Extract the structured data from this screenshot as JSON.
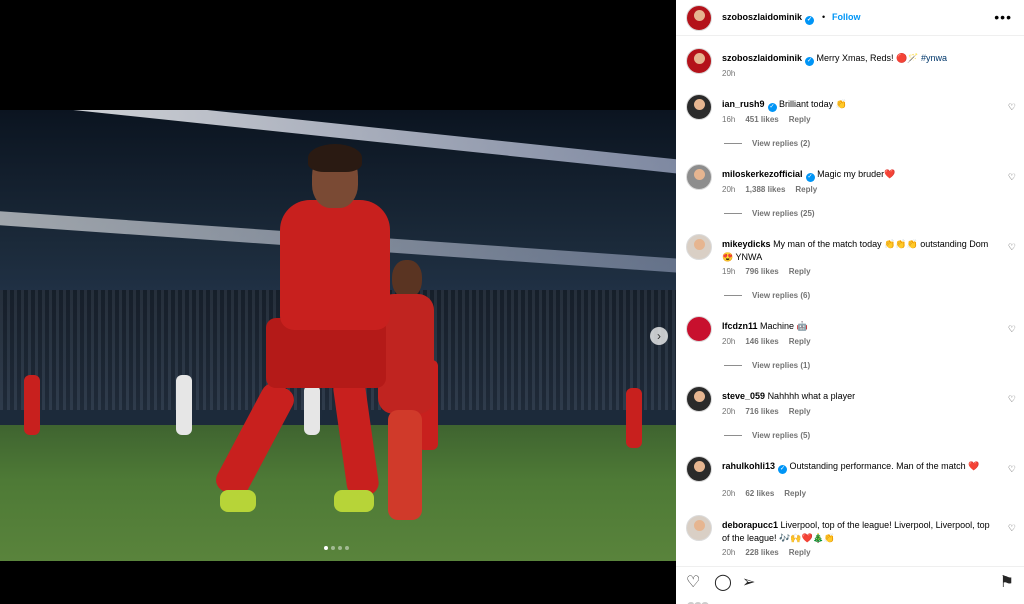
{
  "post": {
    "author": "szoboszlaidominik",
    "follow_label": "Follow",
    "separator": "•",
    "more_label": "•••",
    "next_label": "›",
    "slides_total": 4,
    "slide_active": 1
  },
  "caption": {
    "username": "szoboszlaidominik",
    "text": "Merry Xmas, Reds! 🔴🪄 ",
    "hashtag": "#ynwa",
    "time": "20h"
  },
  "comments": [
    {
      "username": "ian_rush9",
      "verified": true,
      "text": "Brilliant today 👏",
      "time": "16h",
      "likes": "451 likes",
      "reply": "Reply",
      "view_replies": "View replies (2)"
    },
    {
      "username": "miloskerkezofficial",
      "verified": true,
      "text": "Magic my bruder❤️",
      "time": "20h",
      "likes": "1,388 likes",
      "reply": "Reply",
      "view_replies": "View replies (25)"
    },
    {
      "username": "mikeydicks",
      "verified": false,
      "text": "My man of the match today 👏👏👏 outstanding Dom 😍 YNWA",
      "time": "19h",
      "likes": "796 likes",
      "reply": "Reply",
      "view_replies": "View replies (6)"
    },
    {
      "username": "lfcdzn11",
      "verified": false,
      "text": "Machine 🤖",
      "time": "20h",
      "likes": "146 likes",
      "reply": "Reply",
      "view_replies": "View replies (1)"
    },
    {
      "username": "steve_059",
      "verified": false,
      "text": "Nahhhh what a player",
      "time": "20h",
      "likes": "716 likes",
      "reply": "Reply",
      "view_replies": "View replies (5)"
    },
    {
      "username": "rahulkohli13",
      "verified": true,
      "text": "Outstanding performance. Man of the match ❤️",
      "time": "20h",
      "likes": "62 likes",
      "reply": "Reply",
      "view_replies": ""
    },
    {
      "username": "deborapucc1",
      "verified": false,
      "text": "Liverpool, top of the league! Liverpool, Liverpool, top of the league! 🎶🙌❤️🎄👏",
      "time": "20h",
      "likes": "228 likes",
      "reply": "Reply",
      "view_replies": ""
    }
  ],
  "actions": {
    "like": "♡",
    "comment": "◯",
    "share": "➢",
    "save": "⚑"
  },
  "colors": {
    "accent": "#0095f6",
    "liverpool_red": "#c8102e"
  }
}
